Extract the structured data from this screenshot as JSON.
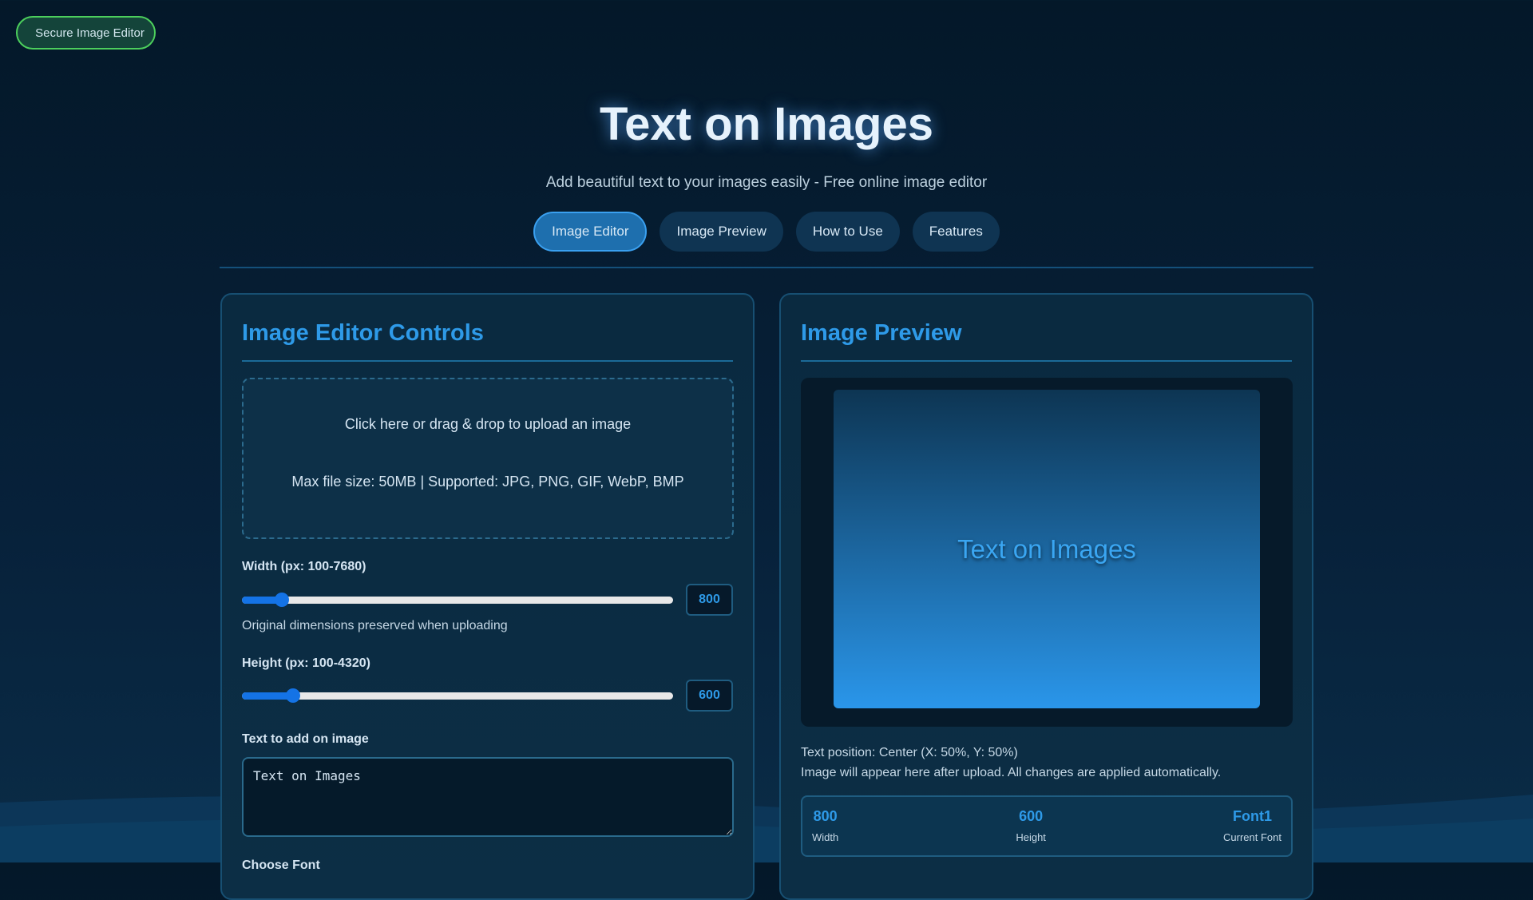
{
  "badge": "Secure Image Editor",
  "title": "Text on Images",
  "subtitle": "Add beautiful text to your images easily - Free online image editor",
  "tabs": [
    {
      "label": "Image Editor"
    },
    {
      "label": "Image Preview"
    },
    {
      "label": "How to Use"
    },
    {
      "label": "Features"
    }
  ],
  "controls": {
    "heading": "Image Editor Controls",
    "upload_main": "Click here or drag & drop to upload an image",
    "upload_sub": "Max file size: 50MB | Supported: JPG, PNG, GIF, WebP, BMP",
    "width_label": "Width (px: 100-7680)",
    "width_value": "800",
    "width_min": 100,
    "width_max": 7680,
    "width_hint": "Original dimensions preserved when uploading",
    "height_label": "Height (px: 100-4320)",
    "height_value": "600",
    "height_min": 100,
    "height_max": 4320,
    "text_label": "Text to add on image",
    "text_value": "Text on Images",
    "font_label": "Choose Font"
  },
  "preview": {
    "heading": "Image Preview",
    "canvas_text": "Text on Images",
    "position": "Text position: Center (X: 50%, Y: 50%)",
    "info": "Image will appear here after upload. All changes are applied automatically.",
    "stats": [
      {
        "value": "800",
        "label": "Width"
      },
      {
        "value": "600",
        "label": "Height"
      },
      {
        "value": "Font1",
        "label": "Current Font"
      }
    ]
  },
  "colors": {
    "accent": "#2e9ae8",
    "badge_border": "#4ccf5c",
    "slider": "#1473e6"
  }
}
